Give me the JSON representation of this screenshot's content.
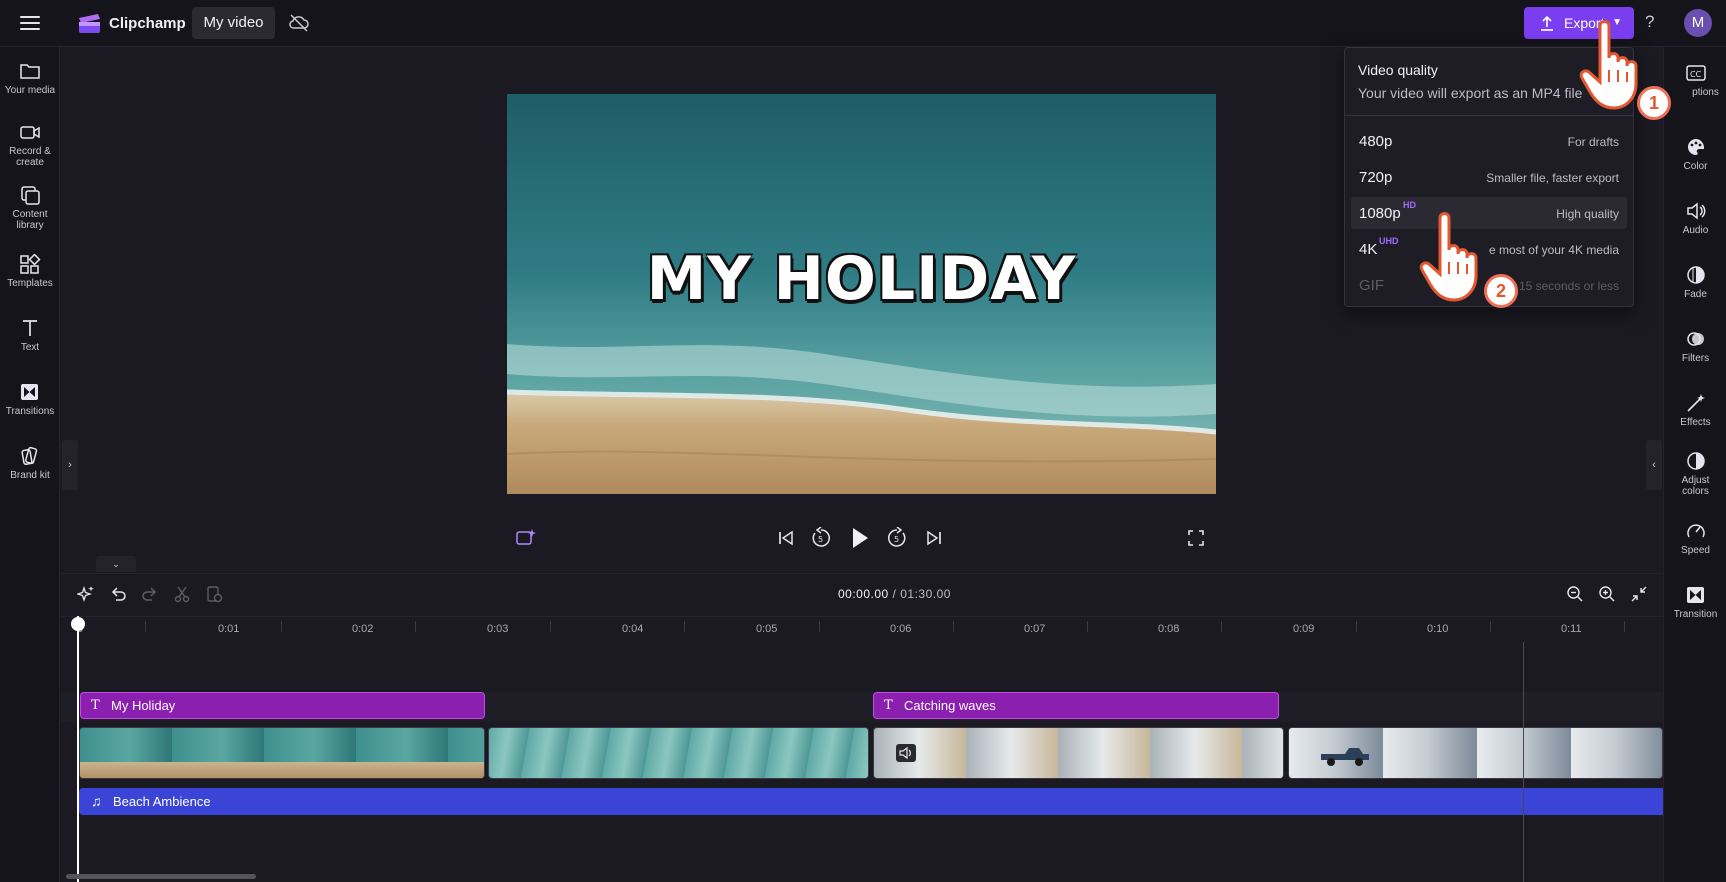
{
  "topbar": {
    "app_name": "Clipchamp",
    "project_name": "My video",
    "export_label": "Export",
    "avatar_initial": "M",
    "help": "?"
  },
  "left_sidebar": {
    "items": [
      {
        "label": "Your media",
        "icon": "folder-icon"
      },
      {
        "label": "Record &",
        "label2": "create",
        "icon": "camera-icon"
      },
      {
        "label": "Content",
        "label2": "library",
        "icon": "content-library-icon"
      },
      {
        "label": "Templates",
        "icon": "templates-icon"
      },
      {
        "label": "Text",
        "icon": "text-icon"
      },
      {
        "label": "Transitions",
        "icon": "transitions-icon"
      },
      {
        "label": "Brand kit",
        "icon": "brand-kit-icon"
      }
    ]
  },
  "right_sidebar": {
    "items": [
      {
        "label": "ptions",
        "icon": "captions-icon"
      },
      {
        "label": "Color",
        "icon": "color-palette-icon"
      },
      {
        "label": "Audio",
        "icon": "speaker-icon"
      },
      {
        "label": "Fade",
        "icon": "fade-icon"
      },
      {
        "label": "Filters",
        "icon": "filters-icon"
      },
      {
        "label": "Effects",
        "icon": "magic-wand-icon"
      },
      {
        "label": "Adjust",
        "label2": "colors",
        "icon": "adjust-colors-icon"
      },
      {
        "label": "Speed",
        "icon": "speedometer-icon"
      },
      {
        "label": "Transition",
        "icon": "transition-icon"
      }
    ]
  },
  "preview": {
    "title_text": "MY HOLIDAY"
  },
  "export_menu": {
    "title": "Video quality",
    "subtitle": "Your video will export as an MP4 file",
    "options": [
      {
        "label": "480p",
        "badge": "",
        "desc": "For drafts"
      },
      {
        "label": "720p",
        "badge": "",
        "desc": "Smaller file, faster export"
      },
      {
        "label": "1080p",
        "badge": "HD",
        "desc": "High quality"
      },
      {
        "label": "4K",
        "badge": "UHD",
        "desc": "e most of your 4K media"
      },
      {
        "label": "GIF",
        "badge": "",
        "desc": "15 seconds or less"
      }
    ],
    "steps": [
      "1",
      "2"
    ]
  },
  "timeline": {
    "current_time": "00:00.00",
    "total_time": " / 01:30.00",
    "ruler_labels": [
      "0:01",
      "0:02",
      "0:03",
      "0:04",
      "0:05",
      "0:06",
      "0:07",
      "0:08",
      "0:09",
      "0:10",
      "0:11"
    ],
    "text_clips": [
      "My Holiday",
      "Catching waves"
    ],
    "audio_clip": "Beach Ambience"
  },
  "colors": {
    "accent": "#7a3ef0",
    "text_clip": "#8a1fb0",
    "audio_clip": "#3a45d8",
    "step_badge": "#f07055"
  }
}
